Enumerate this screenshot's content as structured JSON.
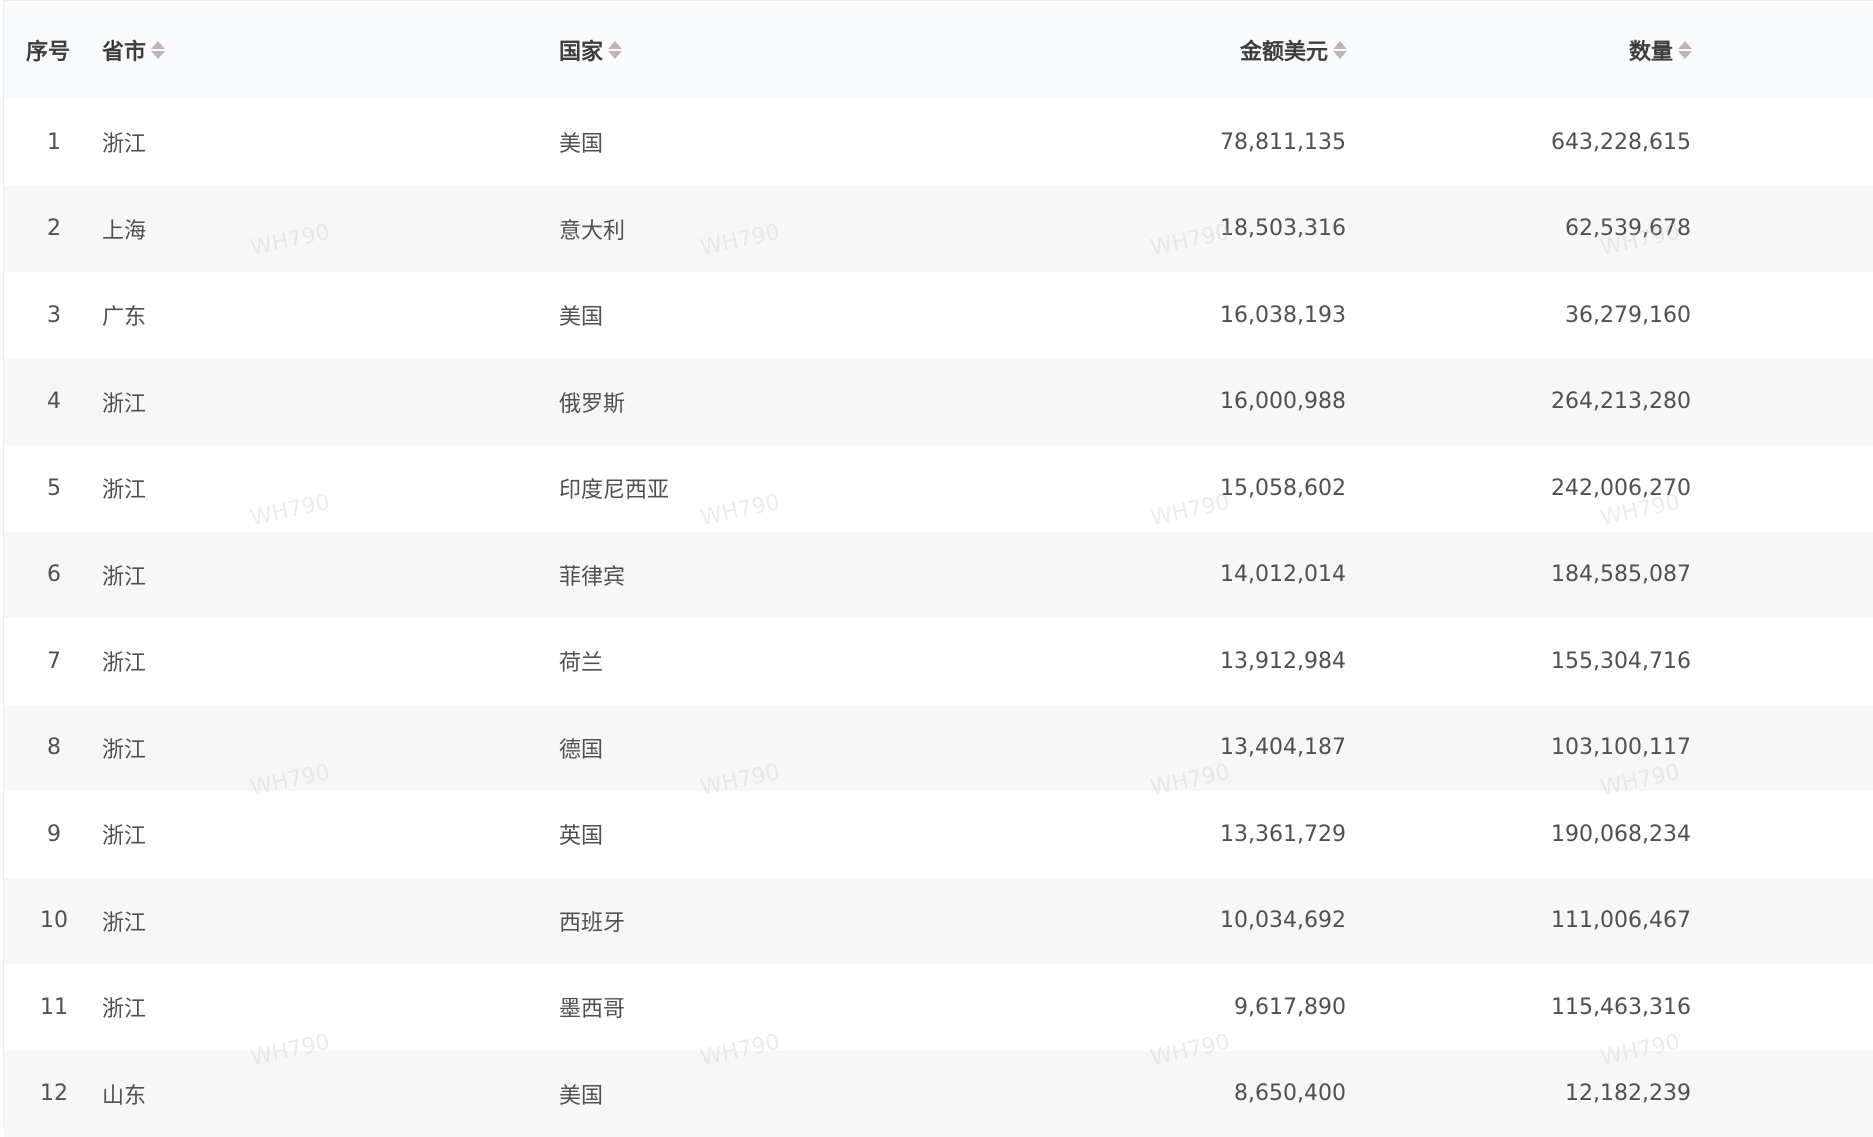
{
  "table": {
    "headers": {
      "index": "序号",
      "province": "省市",
      "country": "国家",
      "amount": "金额美元",
      "quantity": "数量"
    },
    "rows": [
      {
        "index": "1",
        "province": "浙江",
        "country": "美国",
        "amount": "78,811,135",
        "quantity": "643,228,615"
      },
      {
        "index": "2",
        "province": "上海",
        "country": "意大利",
        "amount": "18,503,316",
        "quantity": "62,539,678"
      },
      {
        "index": "3",
        "province": "广东",
        "country": "美国",
        "amount": "16,038,193",
        "quantity": "36,279,160"
      },
      {
        "index": "4",
        "province": "浙江",
        "country": "俄罗斯",
        "amount": "16,000,988",
        "quantity": "264,213,280"
      },
      {
        "index": "5",
        "province": "浙江",
        "country": "印度尼西亚",
        "amount": "15,058,602",
        "quantity": "242,006,270"
      },
      {
        "index": "6",
        "province": "浙江",
        "country": "菲律宾",
        "amount": "14,012,014",
        "quantity": "184,585,087"
      },
      {
        "index": "7",
        "province": "浙江",
        "country": "荷兰",
        "amount": "13,912,984",
        "quantity": "155,304,716"
      },
      {
        "index": "8",
        "province": "浙江",
        "country": "德国",
        "amount": "13,404,187",
        "quantity": "103,100,117"
      },
      {
        "index": "9",
        "province": "浙江",
        "country": "英国",
        "amount": "13,361,729",
        "quantity": "190,068,234"
      },
      {
        "index": "10",
        "province": "浙江",
        "country": "西班牙",
        "amount": "10,034,692",
        "quantity": "111,006,467"
      },
      {
        "index": "11",
        "province": "浙江",
        "country": "墨西哥",
        "amount": "9,617,890",
        "quantity": "115,463,316"
      },
      {
        "index": "12",
        "province": "山东",
        "country": "美国",
        "amount": "8,650,400",
        "quantity": "12,182,239"
      }
    ]
  },
  "watermark": "WH790"
}
